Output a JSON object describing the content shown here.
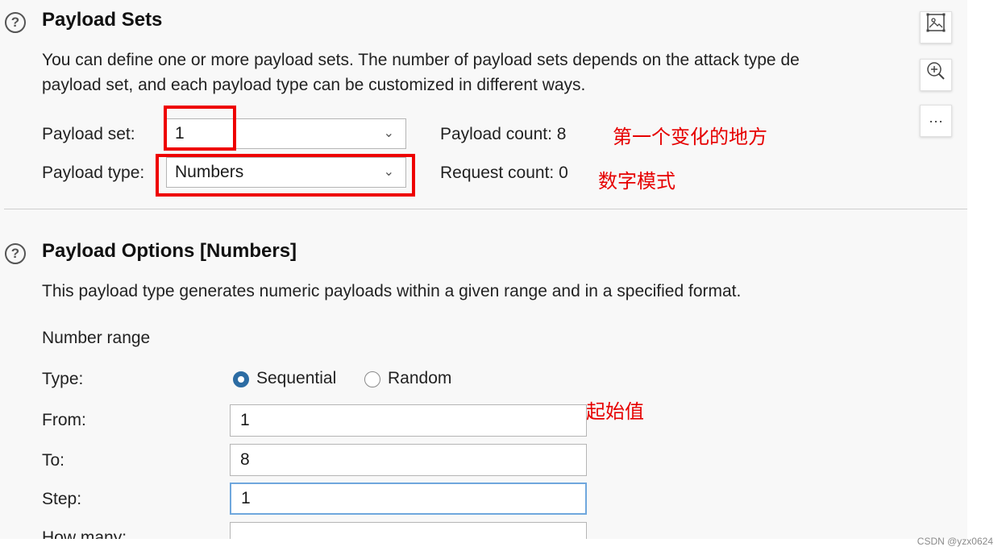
{
  "payload_sets": {
    "title": "Payload Sets",
    "description_line1": "You can define one or more payload sets. The number of payload sets depends on the attack type de",
    "description_line2": "payload set, and each payload type can be customized in different ways.",
    "set_label": "Payload set:",
    "set_value": "1",
    "type_label": "Payload type:",
    "type_value": "Numbers",
    "payload_count": "Payload count: 8",
    "request_count": "Request count: 0"
  },
  "annotations": {
    "first_change": "第一个变化的地方",
    "numeric_mode": "数字模式",
    "start_value": "起始值"
  },
  "payload_options": {
    "title": "Payload Options [Numbers]",
    "description": "This payload type generates numeric payloads within a given range and in a specified format.",
    "number_range_label": "Number range",
    "type_label": "Type:",
    "radio_sequential": "Sequential",
    "radio_random": "Random",
    "selected_type": "Sequential",
    "from_label": "From:",
    "from_value": "1",
    "to_label": "To:",
    "to_value": "8",
    "step_label": "Step:",
    "step_value": "1",
    "how_many_label": "How many:"
  },
  "toolbar": {
    "more_label": "···"
  },
  "icons": [
    "help-icon",
    "chevron-down-icon",
    "image-icon",
    "zoom-in-icon",
    "more-icon"
  ],
  "accent_color": "#ee0000",
  "radio_color": "#2c6ca3",
  "watermark": "CSDN @yzx0624"
}
